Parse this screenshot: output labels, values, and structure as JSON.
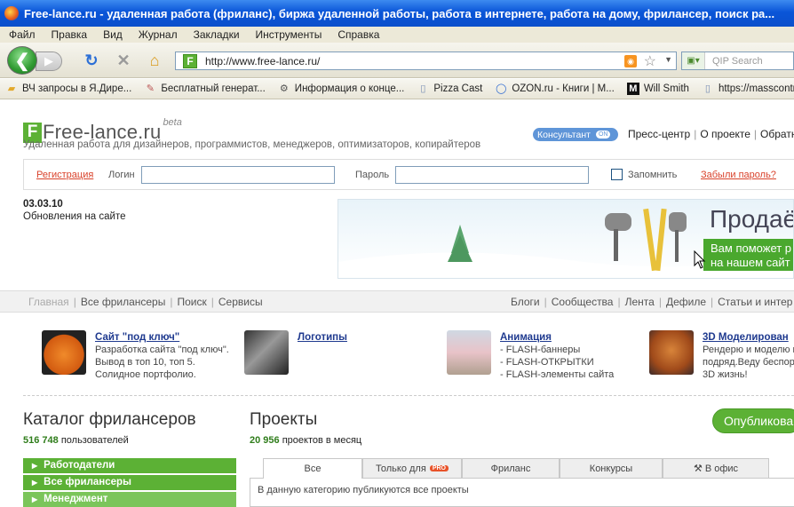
{
  "window": {
    "title": "Free-lance.ru - удаленная работа (фриланс), биржа удаленной работы, работа в интернете, работа на дому, фрилансер, поиск ра..."
  },
  "menu": [
    "Файл",
    "Правка",
    "Вид",
    "Журнал",
    "Закладки",
    "Инструменты",
    "Справка"
  ],
  "address": {
    "url": "http://www.free-lance.ru/",
    "search_placeholder": "QIP Search"
  },
  "bookmarks": [
    "ВЧ запросы в Я.Дире...",
    "Бесплатный генерат...",
    "Информация о конце...",
    "Pizza Cast",
    "OZON.ru - Книги | М...",
    "Will Smith",
    "https://masscontrol.in..."
  ],
  "site": {
    "logo_text": "Free-lance.ru",
    "logo_beta": "beta",
    "tagline": "Удаленная работа для дизайнеров, программистов, менеджеров, оптимизаторов, копирайтеров",
    "consultant": "Консультант",
    "consultant_status": "ON",
    "toplinks": [
      "Пресс-центр",
      "О проекте",
      "Обратная"
    ],
    "login": {
      "register": "Регистрация",
      "login_label": "Логин",
      "password_label": "Пароль",
      "remember": "Запомнить",
      "forgot": "Забыли пароль?"
    },
    "date": "03.03.10",
    "updates": "Обновления на сайте",
    "banner": {
      "heading": "Продаё",
      "line1": "Вам поможет р",
      "line2": "на нашем сайт"
    },
    "nav_left": [
      "Главная",
      "Все фрилансеры",
      "Поиск",
      "Сервисы"
    ],
    "nav_right": [
      "Блоги",
      "Сообщества",
      "Лента",
      "Дефиле",
      "Статьи и интер"
    ],
    "services": [
      {
        "title": "Сайт \"под ключ\"",
        "lines": [
          "Разработка сайта \"под ключ\".",
          "Вывод в топ 10, топ 5.",
          "Солидное портфолио."
        ]
      },
      {
        "title": "Логотипы",
        "lines": []
      },
      {
        "title": "Анимация",
        "lines": [
          "- FLASH-баннеры",
          "- FLASH-ОТКРЫТКИ",
          "- FLASH-элементы сайта"
        ]
      },
      {
        "title": "3D Моделирован",
        "lines": [
          "Рендерю и моделю в",
          "подряд.Веду беспор",
          "3D жизнь!"
        ]
      }
    ],
    "catalog": {
      "title": "Каталог фрилансеров",
      "count": "516 748",
      "count_label": "пользователей"
    },
    "projects": {
      "title": "Проекты",
      "count": "20 956",
      "count_label": "проектов в месяц",
      "publish": "Опубликова"
    },
    "catalog_menu": [
      "Работодатели",
      "Все фрилансеры",
      "Менеджмент"
    ],
    "tabs": [
      "Все",
      "Только для",
      "Фриланс",
      "Конкурсы",
      "В офис"
    ],
    "tab_pro": "PRO",
    "tab_body": "В данную категорию публикуются все проекты"
  }
}
